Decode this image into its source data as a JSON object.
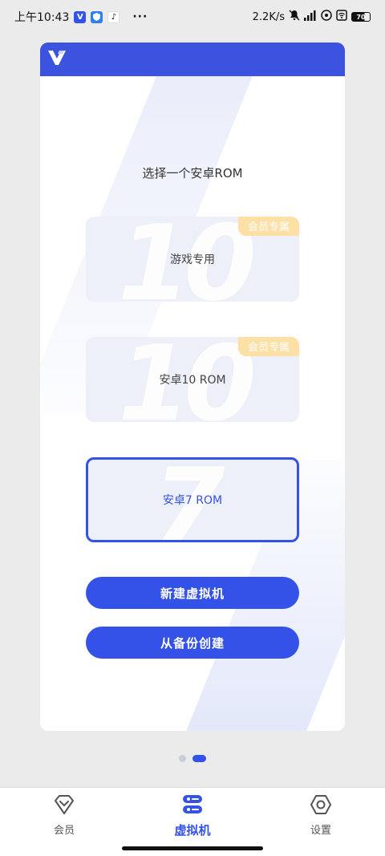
{
  "status_bar": {
    "time": "上午10:43",
    "net_speed": "2.2K/s",
    "battery": "70",
    "more": "···"
  },
  "card": {
    "title": "选择一个安卓ROM",
    "roms": [
      {
        "label": "游戏专用",
        "badge": "会员专属",
        "watermark": "10",
        "selected": false
      },
      {
        "label": "安卓10 ROM",
        "badge": "会员专属",
        "watermark": "10",
        "selected": false
      },
      {
        "label": "安卓7 ROM",
        "badge": "",
        "watermark": "7",
        "selected": true
      }
    ],
    "buttons": {
      "new_vm": "新建虚拟机",
      "from_backup": "从备份创建"
    }
  },
  "pager": {
    "total": 2,
    "active": 2
  },
  "bottom_nav": [
    {
      "label": "会员",
      "icon": "diamond-icon",
      "active": false
    },
    {
      "label": "虚拟机",
      "icon": "server-icon",
      "active": true
    },
    {
      "label": "设置",
      "icon": "hexagon-gear-icon",
      "active": false
    }
  ],
  "colors": {
    "accent": "#3452e8",
    "header": "#3c53e0",
    "badge": "#fde0a6",
    "rom_bg": "#edf0f8"
  }
}
